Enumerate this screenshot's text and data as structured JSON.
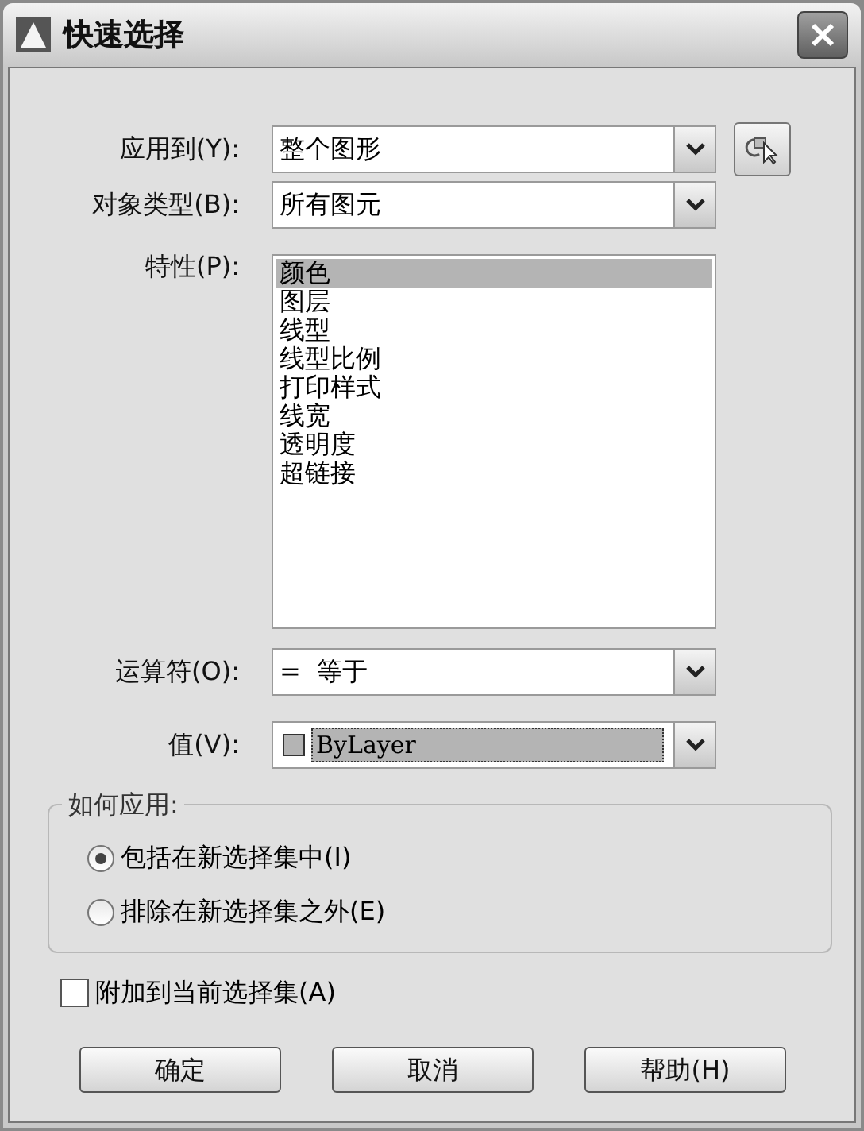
{
  "window": {
    "title": "快速选择"
  },
  "apply_to": {
    "label": "应用到(Y):",
    "value": "整个图形"
  },
  "object_type": {
    "label": "对象类型(B):",
    "value": "所有图元"
  },
  "properties": {
    "label": "特性(P):",
    "items": [
      {
        "label": "颜色",
        "selected": true
      },
      {
        "label": "图层",
        "selected": false
      },
      {
        "label": "线型",
        "selected": false
      },
      {
        "label": "线型比例",
        "selected": false
      },
      {
        "label": "打印样式",
        "selected": false
      },
      {
        "label": "线宽",
        "selected": false
      },
      {
        "label": "透明度",
        "selected": false
      },
      {
        "label": "超链接",
        "selected": false
      }
    ]
  },
  "operator": {
    "label": "运算符(O):",
    "value": "=  等于"
  },
  "value": {
    "label": "值(V):",
    "value": "ByLayer",
    "color": "#b4b4b4"
  },
  "how_to_apply": {
    "label": "如何应用:",
    "options": [
      {
        "label": "包括在新选择集中(I)",
        "selected": true
      },
      {
        "label": "排除在新选择集之外(E)",
        "selected": false
      }
    ]
  },
  "append": {
    "label": "附加到当前选择集(A)",
    "checked": false
  },
  "buttons": [
    "确定",
    "取消",
    "帮助(H)"
  ]
}
